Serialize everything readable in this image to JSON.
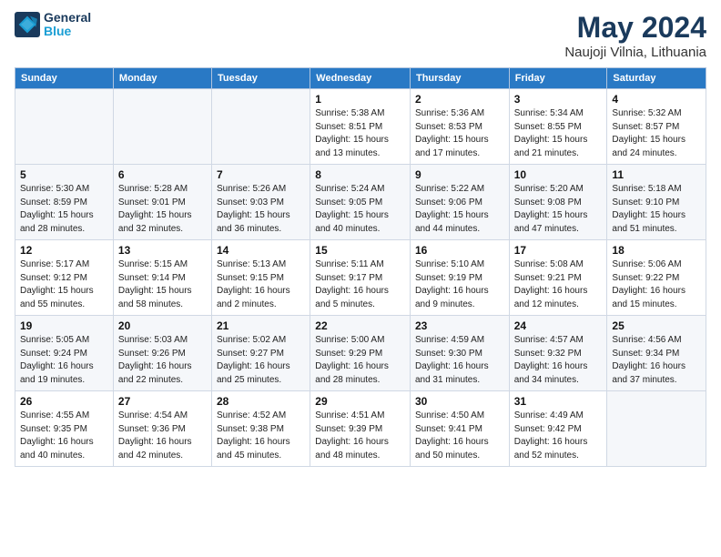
{
  "header": {
    "logo_line1": "General",
    "logo_line2": "Blue",
    "month_title": "May 2024",
    "location": "Naujoji Vilnia, Lithuania"
  },
  "weekdays": [
    "Sunday",
    "Monday",
    "Tuesday",
    "Wednesday",
    "Thursday",
    "Friday",
    "Saturday"
  ],
  "rows": [
    [
      {
        "day": "",
        "sunrise": "",
        "sunset": "",
        "daylight": ""
      },
      {
        "day": "",
        "sunrise": "",
        "sunset": "",
        "daylight": ""
      },
      {
        "day": "",
        "sunrise": "",
        "sunset": "",
        "daylight": ""
      },
      {
        "day": "1",
        "sunrise": "Sunrise: 5:38 AM",
        "sunset": "Sunset: 8:51 PM",
        "daylight": "Daylight: 15 hours and 13 minutes."
      },
      {
        "day": "2",
        "sunrise": "Sunrise: 5:36 AM",
        "sunset": "Sunset: 8:53 PM",
        "daylight": "Daylight: 15 hours and 17 minutes."
      },
      {
        "day": "3",
        "sunrise": "Sunrise: 5:34 AM",
        "sunset": "Sunset: 8:55 PM",
        "daylight": "Daylight: 15 hours and 21 minutes."
      },
      {
        "day": "4",
        "sunrise": "Sunrise: 5:32 AM",
        "sunset": "Sunset: 8:57 PM",
        "daylight": "Daylight: 15 hours and 24 minutes."
      }
    ],
    [
      {
        "day": "5",
        "sunrise": "Sunrise: 5:30 AM",
        "sunset": "Sunset: 8:59 PM",
        "daylight": "Daylight: 15 hours and 28 minutes."
      },
      {
        "day": "6",
        "sunrise": "Sunrise: 5:28 AM",
        "sunset": "Sunset: 9:01 PM",
        "daylight": "Daylight: 15 hours and 32 minutes."
      },
      {
        "day": "7",
        "sunrise": "Sunrise: 5:26 AM",
        "sunset": "Sunset: 9:03 PM",
        "daylight": "Daylight: 15 hours and 36 minutes."
      },
      {
        "day": "8",
        "sunrise": "Sunrise: 5:24 AM",
        "sunset": "Sunset: 9:05 PM",
        "daylight": "Daylight: 15 hours and 40 minutes."
      },
      {
        "day": "9",
        "sunrise": "Sunrise: 5:22 AM",
        "sunset": "Sunset: 9:06 PM",
        "daylight": "Daylight: 15 hours and 44 minutes."
      },
      {
        "day": "10",
        "sunrise": "Sunrise: 5:20 AM",
        "sunset": "Sunset: 9:08 PM",
        "daylight": "Daylight: 15 hours and 47 minutes."
      },
      {
        "day": "11",
        "sunrise": "Sunrise: 5:18 AM",
        "sunset": "Sunset: 9:10 PM",
        "daylight": "Daylight: 15 hours and 51 minutes."
      }
    ],
    [
      {
        "day": "12",
        "sunrise": "Sunrise: 5:17 AM",
        "sunset": "Sunset: 9:12 PM",
        "daylight": "Daylight: 15 hours and 55 minutes."
      },
      {
        "day": "13",
        "sunrise": "Sunrise: 5:15 AM",
        "sunset": "Sunset: 9:14 PM",
        "daylight": "Daylight: 15 hours and 58 minutes."
      },
      {
        "day": "14",
        "sunrise": "Sunrise: 5:13 AM",
        "sunset": "Sunset: 9:15 PM",
        "daylight": "Daylight: 16 hours and 2 minutes."
      },
      {
        "day": "15",
        "sunrise": "Sunrise: 5:11 AM",
        "sunset": "Sunset: 9:17 PM",
        "daylight": "Daylight: 16 hours and 5 minutes."
      },
      {
        "day": "16",
        "sunrise": "Sunrise: 5:10 AM",
        "sunset": "Sunset: 9:19 PM",
        "daylight": "Daylight: 16 hours and 9 minutes."
      },
      {
        "day": "17",
        "sunrise": "Sunrise: 5:08 AM",
        "sunset": "Sunset: 9:21 PM",
        "daylight": "Daylight: 16 hours and 12 minutes."
      },
      {
        "day": "18",
        "sunrise": "Sunrise: 5:06 AM",
        "sunset": "Sunset: 9:22 PM",
        "daylight": "Daylight: 16 hours and 15 minutes."
      }
    ],
    [
      {
        "day": "19",
        "sunrise": "Sunrise: 5:05 AM",
        "sunset": "Sunset: 9:24 PM",
        "daylight": "Daylight: 16 hours and 19 minutes."
      },
      {
        "day": "20",
        "sunrise": "Sunrise: 5:03 AM",
        "sunset": "Sunset: 9:26 PM",
        "daylight": "Daylight: 16 hours and 22 minutes."
      },
      {
        "day": "21",
        "sunrise": "Sunrise: 5:02 AM",
        "sunset": "Sunset: 9:27 PM",
        "daylight": "Daylight: 16 hours and 25 minutes."
      },
      {
        "day": "22",
        "sunrise": "Sunrise: 5:00 AM",
        "sunset": "Sunset: 9:29 PM",
        "daylight": "Daylight: 16 hours and 28 minutes."
      },
      {
        "day": "23",
        "sunrise": "Sunrise: 4:59 AM",
        "sunset": "Sunset: 9:30 PM",
        "daylight": "Daylight: 16 hours and 31 minutes."
      },
      {
        "day": "24",
        "sunrise": "Sunrise: 4:57 AM",
        "sunset": "Sunset: 9:32 PM",
        "daylight": "Daylight: 16 hours and 34 minutes."
      },
      {
        "day": "25",
        "sunrise": "Sunrise: 4:56 AM",
        "sunset": "Sunset: 9:34 PM",
        "daylight": "Daylight: 16 hours and 37 minutes."
      }
    ],
    [
      {
        "day": "26",
        "sunrise": "Sunrise: 4:55 AM",
        "sunset": "Sunset: 9:35 PM",
        "daylight": "Daylight: 16 hours and 40 minutes."
      },
      {
        "day": "27",
        "sunrise": "Sunrise: 4:54 AM",
        "sunset": "Sunset: 9:36 PM",
        "daylight": "Daylight: 16 hours and 42 minutes."
      },
      {
        "day": "28",
        "sunrise": "Sunrise: 4:52 AM",
        "sunset": "Sunset: 9:38 PM",
        "daylight": "Daylight: 16 hours and 45 minutes."
      },
      {
        "day": "29",
        "sunrise": "Sunrise: 4:51 AM",
        "sunset": "Sunset: 9:39 PM",
        "daylight": "Daylight: 16 hours and 48 minutes."
      },
      {
        "day": "30",
        "sunrise": "Sunrise: 4:50 AM",
        "sunset": "Sunset: 9:41 PM",
        "daylight": "Daylight: 16 hours and 50 minutes."
      },
      {
        "day": "31",
        "sunrise": "Sunrise: 4:49 AM",
        "sunset": "Sunset: 9:42 PM",
        "daylight": "Daylight: 16 hours and 52 minutes."
      },
      {
        "day": "",
        "sunrise": "",
        "sunset": "",
        "daylight": ""
      }
    ]
  ]
}
